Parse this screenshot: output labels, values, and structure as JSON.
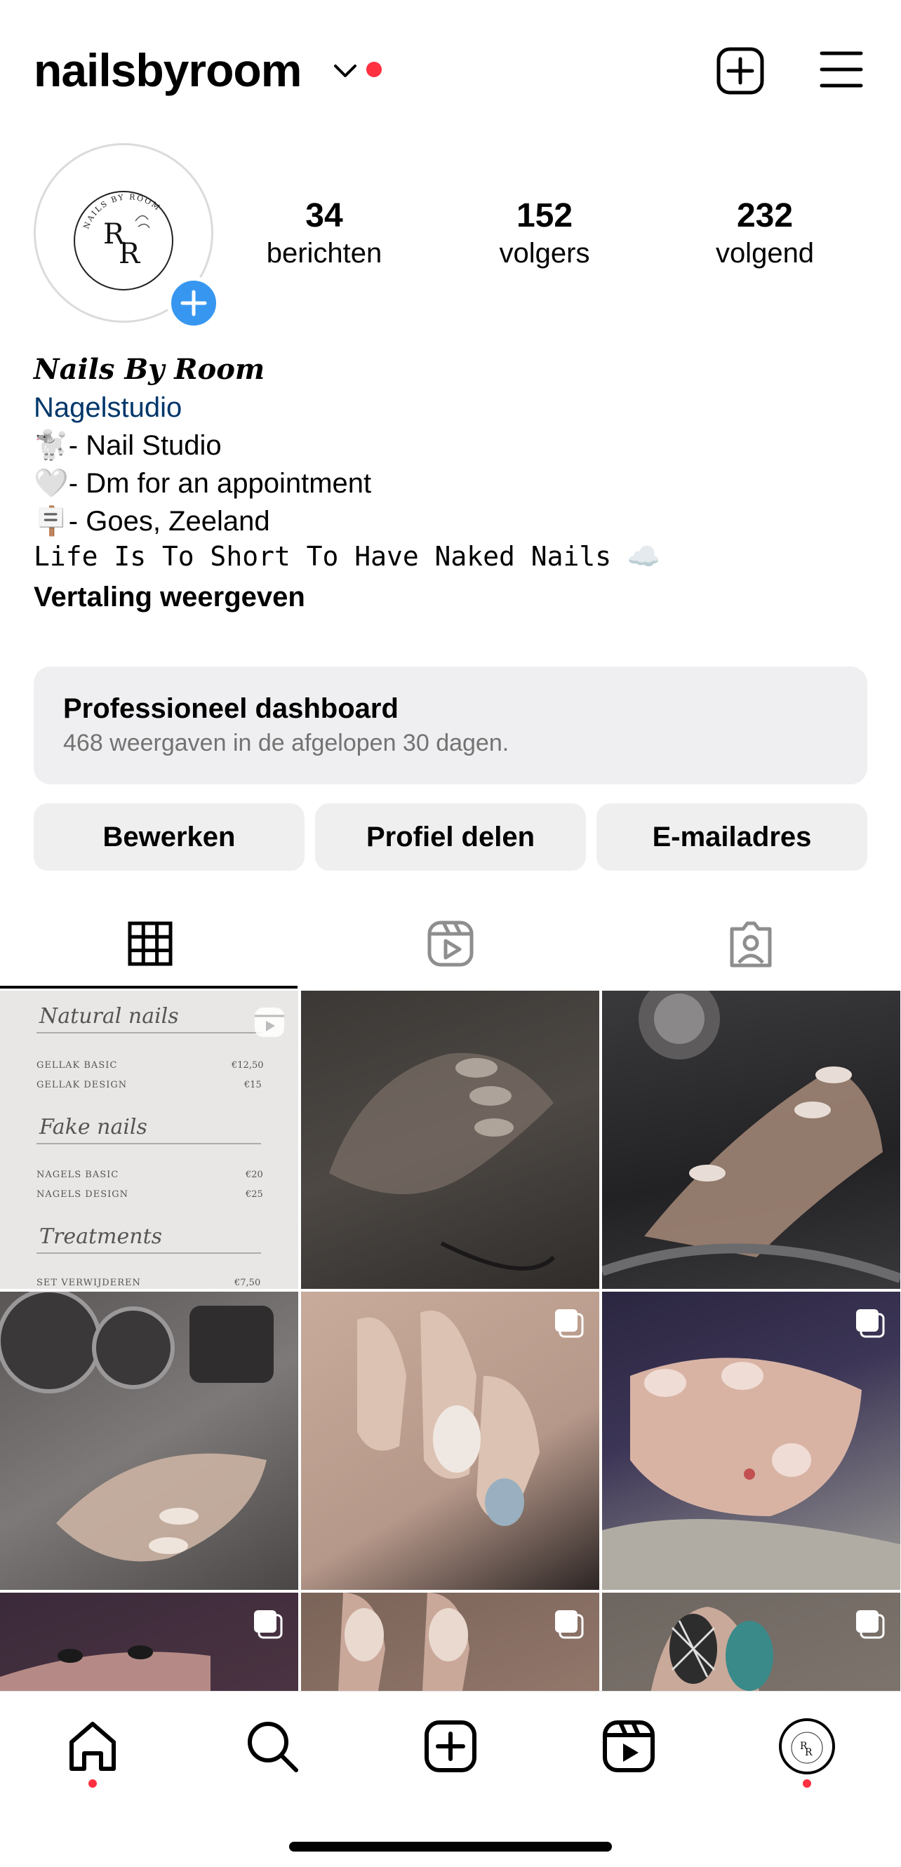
{
  "header": {
    "username": "nailsbyroom",
    "notification_color": "#ff3040",
    "icons": [
      "chevron-down-icon",
      "new-post-icon",
      "menu-icon"
    ]
  },
  "profile": {
    "stats": [
      {
        "value": "34",
        "label": "berichten"
      },
      {
        "value": "152",
        "label": "volgers"
      },
      {
        "value": "232",
        "label": "volgend"
      }
    ],
    "logo_text": {
      "arc": "NAILS BY ROOM",
      "monogram_r1": "R",
      "monogram_r2": "R"
    },
    "accent_color": "#3797f0"
  },
  "bio": {
    "name": "𝑵𝒂𝒊𝒍𝒔 𝑩𝒚 𝑹𝒐𝒐𝒎",
    "category": "Nagelstudio",
    "lines": [
      "🐩- Nail Studio",
      "🤍- Dm for an appointment",
      "🪧- Goes, Zeeland",
      "𝙻𝚒𝚏𝚎 𝙸𝚜 𝚃𝚘 𝚂𝚑𝚘𝚛𝚝 𝚃𝚘 𝙷𝚊𝚟𝚎 𝙽𝚊𝚔𝚎𝚍 𝙽𝚊𝚒𝚕𝚜 ☁️"
    ],
    "translate_label": "Vertaling weergeven"
  },
  "dashboard": {
    "title": "Professioneel dashboard",
    "subtitle": "468 weergaven in de afgelopen 30 dagen."
  },
  "buttons": {
    "edit": "Bewerken",
    "share": "Profiel delen",
    "email": "E-mailadres"
  },
  "tabs": [
    "grid-tab",
    "reels-tab",
    "tagged-tab"
  ],
  "menu_post": {
    "sections": [
      {
        "title": "Natural nails",
        "items": [
          {
            "name": "GELLAK BASIC",
            "price": "€12,50"
          },
          {
            "name": "GELLAK DESIGN",
            "price": "€15"
          }
        ]
      },
      {
        "title": "Fake nails",
        "items": [
          {
            "name": "NAGELS BASIC",
            "price": "€20"
          },
          {
            "name": "NAGELS DESIGN",
            "price": "€25"
          }
        ]
      },
      {
        "title": "Treatments",
        "items": [
          {
            "name": "SET VERWIJDEREN",
            "price": "€7,50"
          }
        ]
      }
    ]
  },
  "grid_posts": [
    {
      "kind": "menu",
      "badge": "reel"
    },
    {
      "kind": "photo",
      "badge": "none",
      "color": "#4a4541"
    },
    {
      "kind": "photo",
      "badge": "none",
      "color": "#2d2c2e"
    },
    {
      "kind": "photo",
      "badge": "none",
      "color": "#6a6767"
    },
    {
      "kind": "photo",
      "badge": "carousel",
      "color": "#c2a594"
    },
    {
      "kind": "photo",
      "badge": "carousel",
      "color": "#3a3450"
    },
    {
      "kind": "photo",
      "badge": "carousel",
      "color": "#3b2a3a"
    },
    {
      "kind": "photo",
      "badge": "carousel",
      "color": "#8b7265"
    },
    {
      "kind": "photo",
      "badge": "carousel",
      "color": "#7a6f66"
    }
  ],
  "bottom_nav": [
    "home-icon",
    "search-icon",
    "create-icon",
    "reels-icon",
    "profile-avatar"
  ]
}
